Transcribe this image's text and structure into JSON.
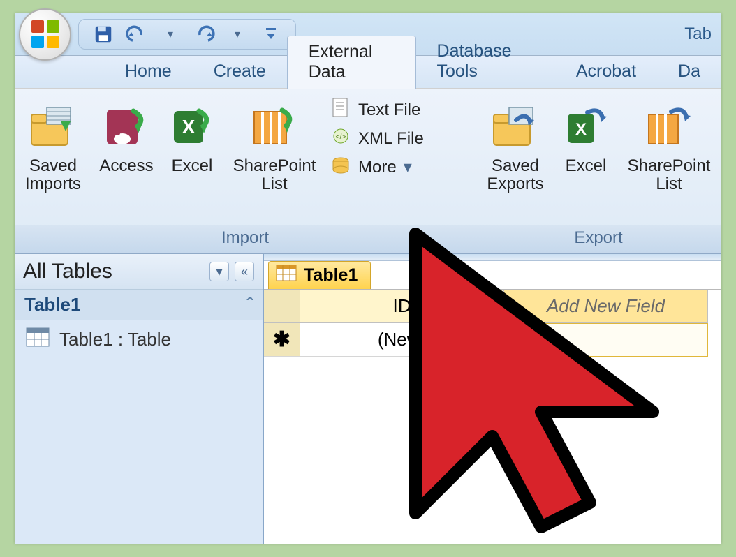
{
  "titlebar": {
    "right_label": "Tab"
  },
  "tabs": {
    "home": "Home",
    "create": "Create",
    "external_data": "External Data",
    "database_tools": "Database Tools",
    "acrobat": "Acrobat",
    "da": "Da"
  },
  "ribbon": {
    "import": {
      "label": "Import",
      "saved_imports": "Saved\nImports",
      "access": "Access",
      "excel": "Excel",
      "sharepoint": "SharePoint\nList",
      "text_file": "Text File",
      "xml_file": "XML File",
      "more": "More"
    },
    "export": {
      "label": "Export",
      "saved_exports": "Saved\nExports",
      "excel": "Excel",
      "sharepoint": "SharePoint\nList"
    }
  },
  "nav": {
    "header": "All Tables",
    "group": "Table1",
    "item1": "Table1 : Table"
  },
  "datasheet": {
    "tab": "Table1",
    "col_id": "ID",
    "col_new": "Add New Field",
    "new_row": "(New)"
  }
}
